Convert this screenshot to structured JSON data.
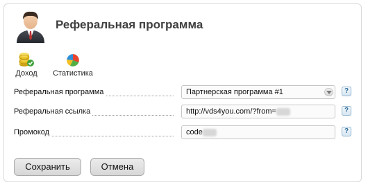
{
  "header": {
    "title": "Реферальная программа",
    "avatar_icon": "user-avatar-icon"
  },
  "toolbar": {
    "income_label": "Доход",
    "income_icon": "coins-icon",
    "stats_label": "Статистика",
    "stats_icon": "pie-chart-icon"
  },
  "form": {
    "program": {
      "label": "Реферальная программа",
      "value": "Партнерская программа #1"
    },
    "link": {
      "label": "Реферальная ссылка",
      "value": "http://vds4you.com/?from="
    },
    "promo": {
      "label": "Промокод",
      "value": "code"
    },
    "help_label": "?"
  },
  "actions": {
    "save_label": "Сохранить",
    "cancel_label": "Отмена"
  },
  "colors": {
    "title": "#404040",
    "help_accent": "#2f6b98",
    "panel_border": "#d9d9d9"
  }
}
